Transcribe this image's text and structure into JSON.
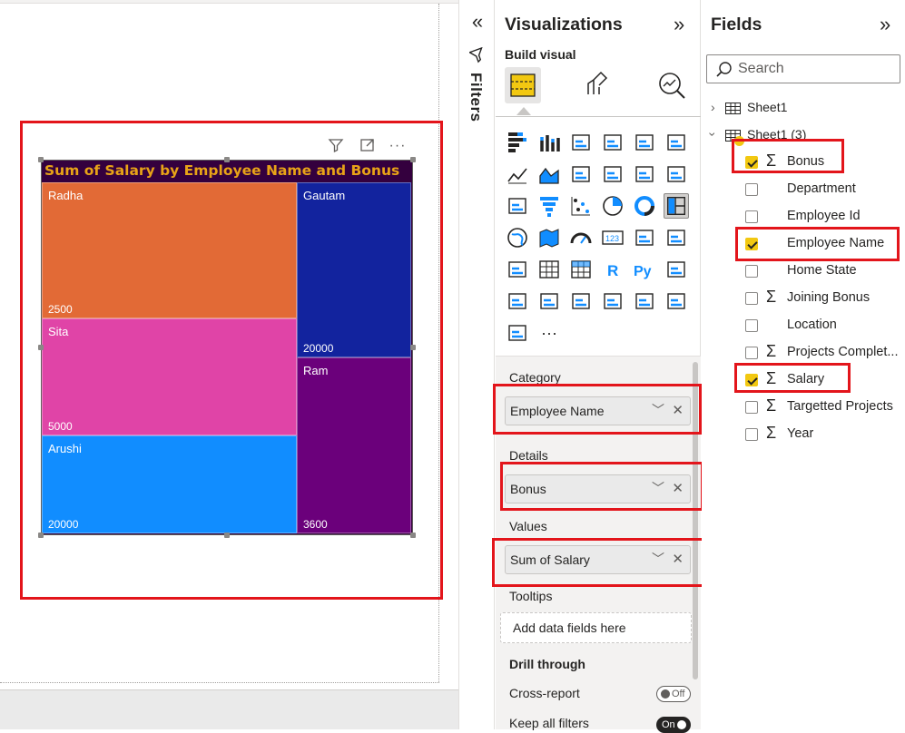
{
  "report": {
    "visual": {
      "title": "Sum of Salary by Employee Name and Bonus",
      "header_icons": [
        "filter-icon",
        "focus-mode-icon",
        "more-options-icon"
      ],
      "colors": {
        "background": "#34003e",
        "title": "#e8a317"
      }
    }
  },
  "chart_data": {
    "type": "treemap",
    "title": "Sum of Salary by Employee Name and Bonus",
    "category": "Employee Name",
    "details": "Bonus",
    "values_field": "Sum of Salary",
    "items": [
      {
        "name": "Radha",
        "bonus": "2500",
        "color": "#e26a36"
      },
      {
        "name": "Sita",
        "bonus": "5000",
        "color": "#e044a7"
      },
      {
        "name": "Arushi",
        "bonus": "20000",
        "color": "#118dff"
      },
      {
        "name": "Gautam",
        "bonus": "20000",
        "color": "#12239e"
      },
      {
        "name": "Ram",
        "bonus": "3600",
        "color": "#6b007b"
      }
    ]
  },
  "filters_pane": {
    "label": "Filters"
  },
  "visualizations": {
    "title": "Visualizations",
    "build_label": "Build visual",
    "more_label": "···",
    "wells": {
      "category_label": "Category",
      "category_value": "Employee Name",
      "details_label": "Details",
      "details_value": "Bonus",
      "values_label": "Values",
      "values_value": "Sum of Salary",
      "tooltips_label": "Tooltips",
      "tooltips_placeholder": "Add data fields here",
      "drill_label": "Drill through",
      "cross_report_label": "Cross-report",
      "cross_report_state": "Off",
      "keep_filters_label": "Keep all filters",
      "keep_filters_state": "On"
    }
  },
  "fields": {
    "title": "Fields",
    "search_placeholder": "Search",
    "tables": [
      {
        "name": "Sheet1",
        "expanded": false
      },
      {
        "name": "Sheet1 (3)",
        "expanded": true
      }
    ],
    "items": [
      {
        "name": "Bonus",
        "checked": true,
        "sigma": true
      },
      {
        "name": "Department",
        "checked": false,
        "sigma": false
      },
      {
        "name": "Employee Id",
        "checked": false,
        "sigma": false
      },
      {
        "name": "Employee Name",
        "checked": true,
        "sigma": false
      },
      {
        "name": "Home State",
        "checked": false,
        "sigma": false
      },
      {
        "name": "Joining Bonus",
        "checked": false,
        "sigma": true
      },
      {
        "name": "Location",
        "checked": false,
        "sigma": false
      },
      {
        "name": "Projects Complet...",
        "checked": false,
        "sigma": true
      },
      {
        "name": "Salary",
        "checked": true,
        "sigma": true
      },
      {
        "name": "Targetted Projects",
        "checked": false,
        "sigma": true
      },
      {
        "name": "Year",
        "checked": false,
        "sigma": true
      }
    ]
  },
  "colors": {
    "accent": "#f2c811",
    "highlight_box": "#e3151b"
  }
}
